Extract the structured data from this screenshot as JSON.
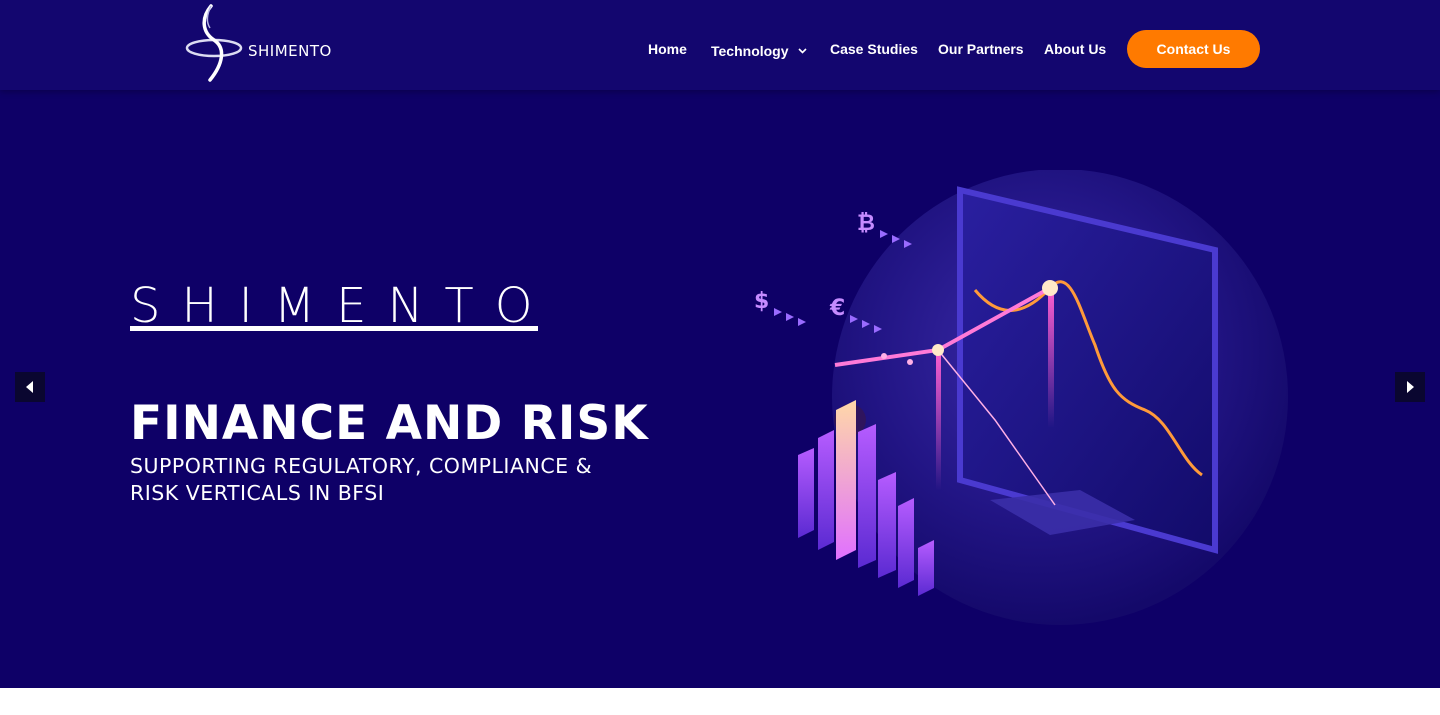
{
  "header": {
    "logo_text": "SHIMENTO",
    "nav": [
      {
        "label": "Home"
      },
      {
        "label": "Technology",
        "has_dropdown": true
      },
      {
        "label": "Case Studies"
      },
      {
        "label": "Our Partners"
      },
      {
        "label": "About Us"
      }
    ],
    "cta_label": "Contact Us"
  },
  "hero": {
    "brand": "SHIMENTO",
    "headline": "FINANCE AND RISK",
    "subline": "SUPPORTING REGULATORY, COMPLIANCE & RISK VERTICALS IN BFSI",
    "illustration_symbols": [
      "₿",
      "$",
      "€"
    ],
    "prev_icon": "caret-left-icon",
    "next_icon": "caret-right-icon"
  },
  "colors": {
    "header_bg": "#13066f",
    "hero_bg": "#0e0067",
    "accent_orange": "#ff7a00",
    "text": "#ffffff"
  }
}
